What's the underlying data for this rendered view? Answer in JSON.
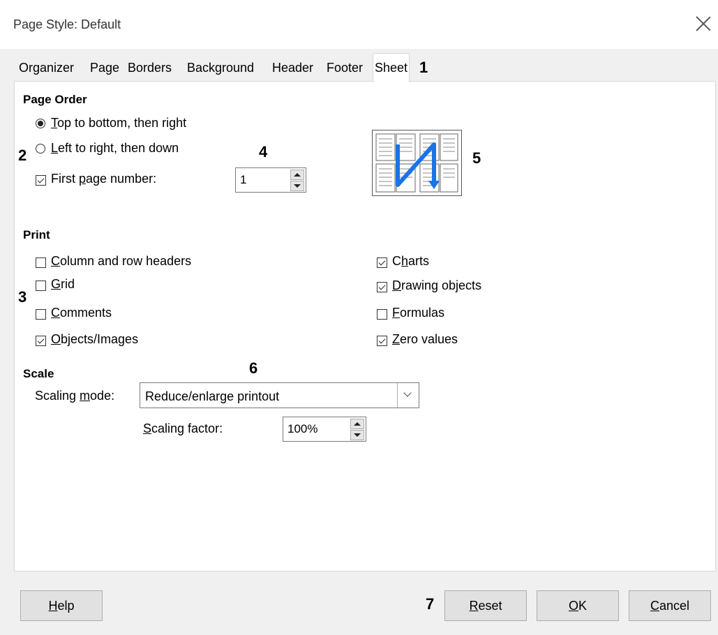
{
  "window": {
    "title": "Page Style: Default"
  },
  "tabs": [
    {
      "label": "Organizer"
    },
    {
      "label": "Page"
    },
    {
      "label": "Borders"
    },
    {
      "label": "Background"
    },
    {
      "label": "Header"
    },
    {
      "label": "Footer"
    },
    {
      "label": "Sheet",
      "active": true
    }
  ],
  "page_order": {
    "heading": "Page Order",
    "options": [
      {
        "mnemonic": "T",
        "rest": "op to bottom, then right",
        "selected": true
      },
      {
        "mnemonic": "L",
        "rest": "eft to right, then down",
        "selected": false
      }
    ],
    "first_page": {
      "pre": "First ",
      "mnemonic": "p",
      "rest": "age number:",
      "checked": true,
      "value": "1"
    }
  },
  "print": {
    "heading": "Print",
    "left": [
      {
        "mnemonic": "C",
        "rest": "olumn and row headers",
        "checked": false
      },
      {
        "mnemonic": "G",
        "rest": "rid",
        "checked": false
      },
      {
        "mnemonic": "C",
        "rest": "omments",
        "checked": false
      },
      {
        "mnemonic": "O",
        "rest": "bjects/Images",
        "checked": true
      }
    ],
    "right": [
      {
        "pre": "C",
        "mnemonic": "h",
        "rest": "arts",
        "checked": true
      },
      {
        "mnemonic": "D",
        "rest": "rawing objects",
        "checked": true
      },
      {
        "mnemonic": "F",
        "rest": "ormulas",
        "checked": false
      },
      {
        "mnemonic": "Z",
        "rest": "ero values",
        "checked": true
      }
    ]
  },
  "scale": {
    "heading": "Scale",
    "mode_label": {
      "pre": "Scaling ",
      "mnemonic": "m",
      "rest": "ode:"
    },
    "mode_value": "Reduce/enlarge printout",
    "factor_label": {
      "mnemonic": "S",
      "rest": "caling factor:"
    },
    "factor_value": "100%"
  },
  "callouts": [
    "1",
    "2",
    "3",
    "4",
    "5",
    "6",
    "7"
  ],
  "buttons": {
    "help": {
      "mnemonic": "H",
      "rest": "elp"
    },
    "reset": {
      "mnemonic": "R",
      "rest": "eset"
    },
    "ok": {
      "mnemonic": "O",
      "rest": "K"
    },
    "cancel": {
      "mnemonic": "C",
      "rest": "ancel"
    }
  },
  "colors": {
    "preview_arrow": "#1a73e8"
  }
}
